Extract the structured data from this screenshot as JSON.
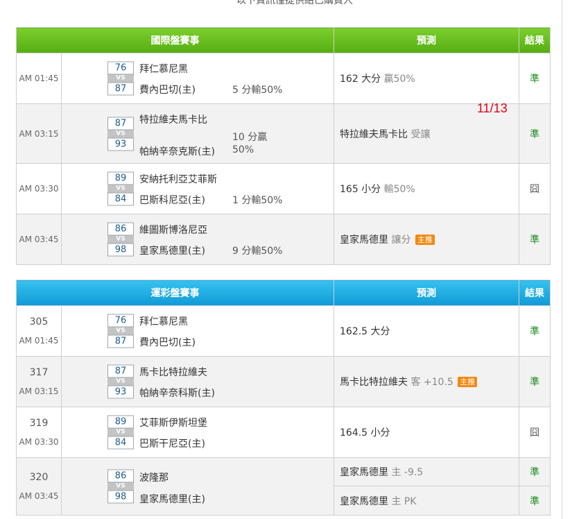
{
  "top_note": "以下資訊僅提供給已購買人",
  "overlay_date": "11/13",
  "intl": {
    "headers": {
      "match": "國際盤賽事",
      "pred": "預測",
      "result": "結果"
    },
    "rows": [
      {
        "time": "AM 01:45",
        "s1": "76",
        "s2": "87",
        "t1": "拜仁慕尼黑",
        "t2": "費內巴切(主)",
        "spread": "5 分輸50%",
        "pred_main": "162 大分",
        "pred_sub": " 贏50%",
        "result": "準"
      },
      {
        "time": "AM 03:15",
        "s1": "87",
        "s2": "93",
        "t1": "特拉維夫馬卡比",
        "t2": "帕納辛奈克斯(主)",
        "spread_a": "10 分贏",
        "spread_b": "50%",
        "pred_main": "特拉維夫馬卡比",
        "pred_sub": " 受讓",
        "result": "準"
      },
      {
        "time": "AM 03:30",
        "s1": "89",
        "s2": "84",
        "t1": "安納托利亞艾菲斯",
        "t2": "巴斯科尼亞(主)",
        "spread": "1 分輸50%",
        "pred_main": "165 小分",
        "pred_sub": " 輸50%",
        "result": "囧"
      },
      {
        "time": "AM 03:45",
        "s1": "86",
        "s2": "98",
        "t1": "維圖斯博洛尼亞",
        "t2": "皇家馬德里(主)",
        "spread": "9 分輸50%",
        "pred_main": "皇家馬德里",
        "pred_sub": " 讓分",
        "badge": "主推",
        "result": "準"
      }
    ]
  },
  "lottery": {
    "headers": {
      "match": "運彩盤賽事",
      "pred": "預測",
      "result": "結果"
    },
    "rows": [
      {
        "num": "305",
        "time": "AM 01:45",
        "s1": "76",
        "s2": "87",
        "t1": "拜仁慕尼黑",
        "t2": "費內巴切(主)",
        "pred_main": "162.5 大分",
        "result": "準"
      },
      {
        "num": "317",
        "time": "AM 03:15",
        "s1": "87",
        "s2": "93",
        "t1": "馬卡比特拉維夫",
        "t2": "帕納辛奈科斯(主)",
        "pred_main": "馬卡比特拉維夫",
        "pred_sub": " 客 +10.5",
        "badge": "主推",
        "result": "準"
      },
      {
        "num": "319",
        "time": "AM 03:30",
        "s1": "89",
        "s2": "84",
        "t1": "艾菲斯伊斯坦堡",
        "t2": "巴斯干尼亞(主)",
        "pred_main": "164.5 小分",
        "result": "囧"
      },
      {
        "num": "320",
        "time": "AM 03:45",
        "s1": "86",
        "s2": "98",
        "t1": "波隆那",
        "t2": "皇家馬德里(主)",
        "pred1_main": "皇家馬德里",
        "pred1_sub": " 主 -9.5",
        "result1": "準",
        "pred2_main": "皇家馬德里",
        "pred2_sub": " 主 PK",
        "result2": "準"
      }
    ]
  },
  "vs_label": "VS"
}
